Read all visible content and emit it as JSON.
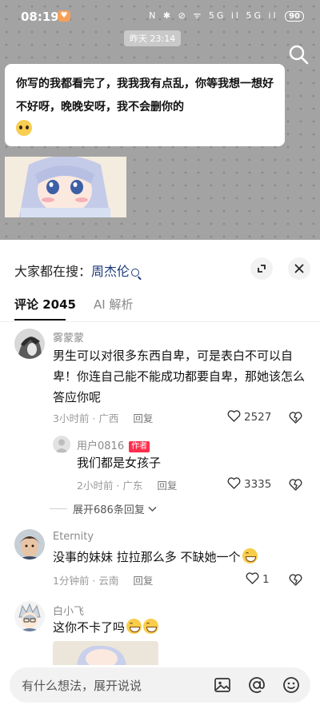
{
  "status_bar": {
    "time": "08:19",
    "icons_text": "N ✱ ⊘ ᯤ 5G il 5G il",
    "battery": "90"
  },
  "chat": {
    "timestamp": "昨天 23:14",
    "message": "你写的我都看完了，我我我有点乱，你等我想一想好不好呀，晚晚安呀，我不会删你的"
  },
  "sheet": {
    "search_prefix": "大家都在搜：",
    "search_keyword": "周杰伦",
    "tabs": [
      {
        "label": "评论 2045",
        "active": true
      },
      {
        "label": "AI 解析",
        "active": false
      }
    ]
  },
  "comments": [
    {
      "name": "雾蒙蒙",
      "text": "男生可以对很多东西自卑，可是表白不可以自卑！你连自己能不能成功都要自卑，那她该怎么答应你呢",
      "time_location": "3小时前 · 广西",
      "reply_label": "回复",
      "likes": "2527"
    },
    {
      "name": "用户0816",
      "tag": "作者",
      "text": "我们都是女孩子",
      "time_location": "2小时前 · 广东",
      "reply_label": "回复",
      "likes": "3335"
    },
    {
      "name": "Eternity",
      "text": "没事的妹妹 拉拉那么多 不缺她一个",
      "time_location": "1分钟前 · 云南",
      "reply_label": "回复",
      "likes": "1"
    },
    {
      "name": "白小飞",
      "text": "这你不卡了吗"
    }
  ],
  "expand_replies": "展开686条回复",
  "input": {
    "placeholder": "有什么想法，展开说说"
  },
  "colors": {
    "keyword": "#1e3a78",
    "author_tag": "#ff2e4d",
    "bg_gray": "#a3a3a3"
  },
  "icons": [
    "search-icon",
    "expand-icon",
    "close-icon",
    "heart-icon",
    "dislike-icon",
    "chevron-down-icon",
    "image-icon",
    "at-icon",
    "emoji-icon"
  ]
}
